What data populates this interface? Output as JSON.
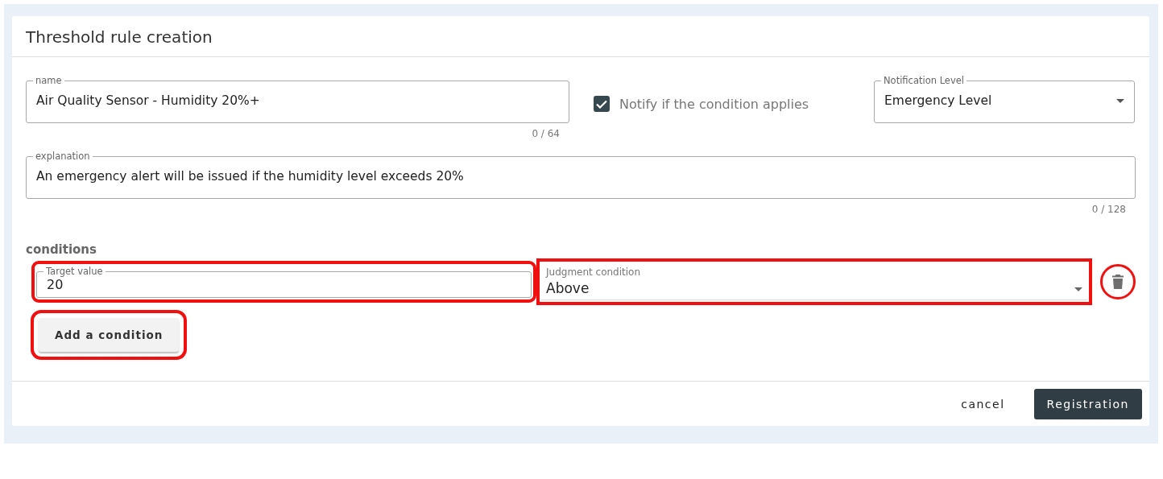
{
  "title": "Threshold rule creation",
  "name_field": {
    "label": "name",
    "value": "Air Quality Sensor - Humidity 20%+",
    "counter": "0 / 64"
  },
  "notify": {
    "label": "Notify if the condition applies",
    "checked": true
  },
  "notification_level": {
    "label": "Notification Level",
    "value": "Emergency Level"
  },
  "explanation_field": {
    "label": "explanation",
    "value": "An emergency alert will be issued if the humidity level exceeds 20%",
    "counter": "0 / 128"
  },
  "conditions": {
    "heading": "conditions",
    "rows": [
      {
        "target": {
          "label": "Target value",
          "value": "20",
          "highlighted": true
        },
        "judgment": {
          "label": "Judgment condition",
          "value": "Above",
          "highlighted": true
        },
        "delete_highlighted": true
      }
    ],
    "add_button": {
      "label": "Add a condition",
      "highlighted": true
    }
  },
  "footer": {
    "buttons": [
      {
        "label": "cancel",
        "kind": "text"
      },
      {
        "label": "Registration",
        "kind": "primary"
      }
    ]
  }
}
